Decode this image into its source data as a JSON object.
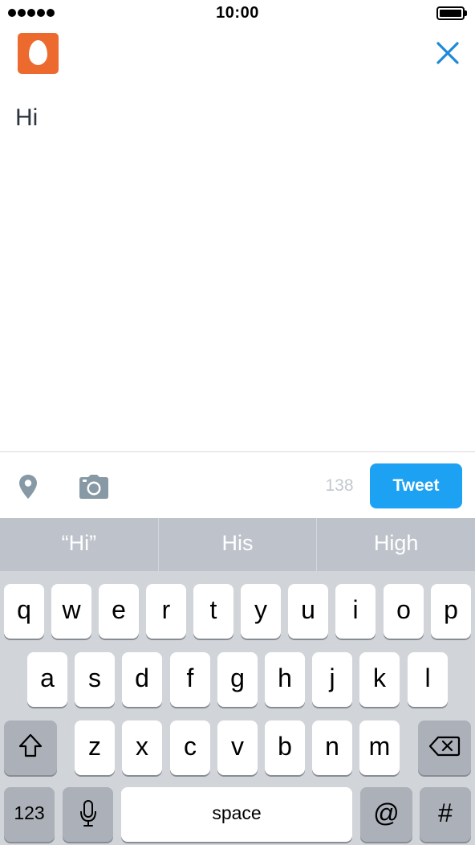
{
  "status_bar": {
    "time": "10:00",
    "signal_bars": 5,
    "battery": 1.0
  },
  "header": {
    "avatar_icon": "egg-avatar-icon",
    "avatar_color": "#ec6a2d",
    "close_icon": "close-icon",
    "close_color": "#1d8ad8"
  },
  "compose": {
    "text": "Hi"
  },
  "toolbar": {
    "location_icon": "location-pin-icon",
    "camera_icon": "camera-icon",
    "char_count": "138",
    "tweet_label": "Tweet",
    "tweet_color": "#1da1f2"
  },
  "predictions": [
    "“Hi”",
    "His",
    "High"
  ],
  "keyboard": {
    "row1": [
      "q",
      "w",
      "e",
      "r",
      "t",
      "y",
      "u",
      "i",
      "o",
      "p"
    ],
    "row2": [
      "a",
      "s",
      "d",
      "f",
      "g",
      "h",
      "j",
      "k",
      "l"
    ],
    "row3": [
      "z",
      "x",
      "c",
      "v",
      "b",
      "n",
      "m"
    ],
    "shift_icon": "shift-icon",
    "delete_icon": "delete-icon",
    "numbers_label": "123",
    "mic_icon": "microphone-icon",
    "space_label": "space",
    "at_label": "@",
    "hash_label": "#"
  }
}
